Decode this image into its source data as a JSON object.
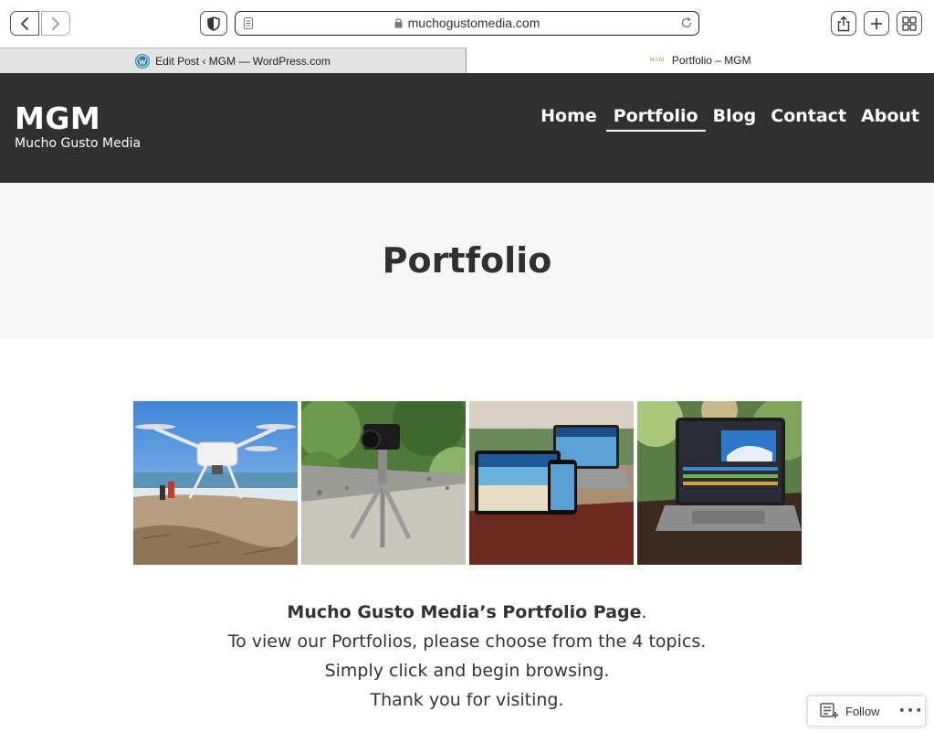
{
  "browser": {
    "url": "muchogustomedia.com",
    "tabs": [
      {
        "label": "Edit Post ‹ MGM — WordPress.com",
        "active": false
      },
      {
        "label": "Portfolio – MGM",
        "favicon_text": "MGM",
        "active": true
      }
    ]
  },
  "site": {
    "title": "MGM",
    "tagline": "Mucho Gusto Media",
    "nav": [
      {
        "label": "Home"
      },
      {
        "label": "Portfolio",
        "active": true
      },
      {
        "label": "Blog"
      },
      {
        "label": "Contact"
      },
      {
        "label": "About"
      }
    ]
  },
  "page": {
    "title": "Portfolio",
    "intro_bold": "Mucho Gusto Media’s Portfolio Page",
    "intro_period": ".",
    "intro_line2": "To view our Portfolios, please choose from the 4 topics.",
    "intro_line3": "Simply click and begin browsing.",
    "intro_line4": "Thank you for visiting.",
    "gallery_icons": [
      "drone-photo",
      "camera-tripod-photo",
      "devices-surfing-photo",
      "laptop-video-editing-photo"
    ]
  },
  "follow_widget": {
    "label": "Follow",
    "more": "•••"
  },
  "colors": {
    "header_bg": "#303030",
    "hero_bg": "#f7f7f7",
    "text": "#333333"
  }
}
